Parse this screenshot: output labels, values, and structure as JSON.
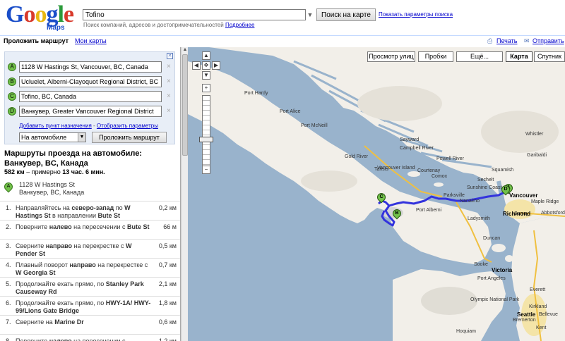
{
  "header": {
    "logo_letters": [
      "G",
      "o",
      "o",
      "g",
      "l",
      "e"
    ],
    "logo_sub": "Maps",
    "search_value": "Tofino",
    "search_button": "Поиск на карте",
    "search_options": "Показать параметры поиска",
    "search_hint": "Поиск компаний, адресов и достопримечательностей",
    "search_hint_link": "Подробнее"
  },
  "topbar": {
    "active_tab": "Проложить маршрут",
    "my_maps": "Мои карты",
    "print": "Печать",
    "send": "Отправить",
    "print_icon": "printer-icon",
    "send_icon": "envelope-icon"
  },
  "directions": {
    "waypoints": [
      {
        "letter": "A",
        "value": "1128 W Hastings St, Vancouver, BC, Canada"
      },
      {
        "letter": "B",
        "value": "Ucluelet, Alberni-Clayoquot Regional District, BC"
      },
      {
        "letter": "C",
        "value": "Tofino, BC, Canada"
      },
      {
        "letter": "D",
        "value": "Ванкувер, Greater Vancouver Regional District"
      }
    ],
    "add_destination": "Добавить пункт назначения",
    "separator": "-",
    "show_options": "Отобразить параметры",
    "mode": "На автомобиле",
    "route_button": "Проложить маршрут",
    "title": "Маршруты проезда на автомобиле: Ванкувер, BC, Канада",
    "summary_distance": "582 км",
    "summary_mid": " – примерно ",
    "summary_time": "13 час. 6 мин.",
    "start_letter": "A",
    "start_line1": "1128 W Hastings St",
    "start_line2": "Ванкувер, BC, Канада"
  },
  "steps": [
    {
      "num": "1.",
      "html": "Направляйтесь на <b>северо-запад</b> по <b>W Hastings St</b> в направлении <b>Bute St</b>",
      "dist": "0,2 км"
    },
    {
      "num": "2.",
      "html": "Поверните <b>налево</b> на пересечении с <b>Bute St</b>",
      "dist": "66 м"
    },
    {
      "num": "3.",
      "html": "Сверните <b>направо</b> на перекрестке с <b>W Pender St</b>",
      "dist": "0,5 км"
    },
    {
      "num": "4.",
      "html": "Плавный поворот <b>направо</b> на перекрестке с <b>W Georgia St</b>",
      "dist": "0,7 км"
    },
    {
      "num": "5.",
      "html": "Продолжайте ехать прямо, по <b>Stanley Park Causeway Rd</b>",
      "dist": "2,1 км"
    },
    {
      "num": "6.",
      "html": "Продолжайте ехать прямо, по <b>HWY-1A/ HWY-99/Lions Gate Bridge</b>",
      "dist": "1,8 км"
    },
    {
      "num": "7.",
      "html": "Сверните на <b>Marine Dr</b>",
      "dist": "0,6 км"
    },
    {
      "num": "8.",
      "html": "Поверните <b>налево</b> на пересечении с",
      "dist": "1,2 км"
    }
  ],
  "map": {
    "buttons": [
      "Просмотр улиц",
      "Пробки",
      "Ещё...",
      "Карта",
      "Спутник"
    ],
    "active_button": "Карта",
    "places": [
      "Port Hardy",
      "Port Alice",
      "Port McNeill",
      "Sayward",
      "Gold River",
      "Tahsis",
      "Powell River",
      "Sechelt",
      "Vancouver Island",
      "Courtenay",
      "Comox",
      "Campbell River",
      "Parksville",
      "Port Alberni",
      "Nanaimo",
      "Ladysmith",
      "Duncan",
      "Whistler",
      "Squamish",
      "Sunshine Coast",
      "Garibaldi",
      "Maple Ridge",
      "Surrey",
      "Abbotsford",
      "Olympic National Park",
      "Kirkland",
      "Everett",
      "Bellevue",
      "Kent",
      "Hoquiam",
      "Sooke",
      "Bremerton",
      "Port Angeles"
    ],
    "cities": [
      "Vancouver",
      "Richmond",
      "Seattle",
      "Victoria"
    ],
    "markers": [
      "A",
      "B",
      "C",
      "D"
    ],
    "route_color": "#3333dd",
    "water_color": "#99b3cc",
    "land_color": "#f2efe9"
  }
}
